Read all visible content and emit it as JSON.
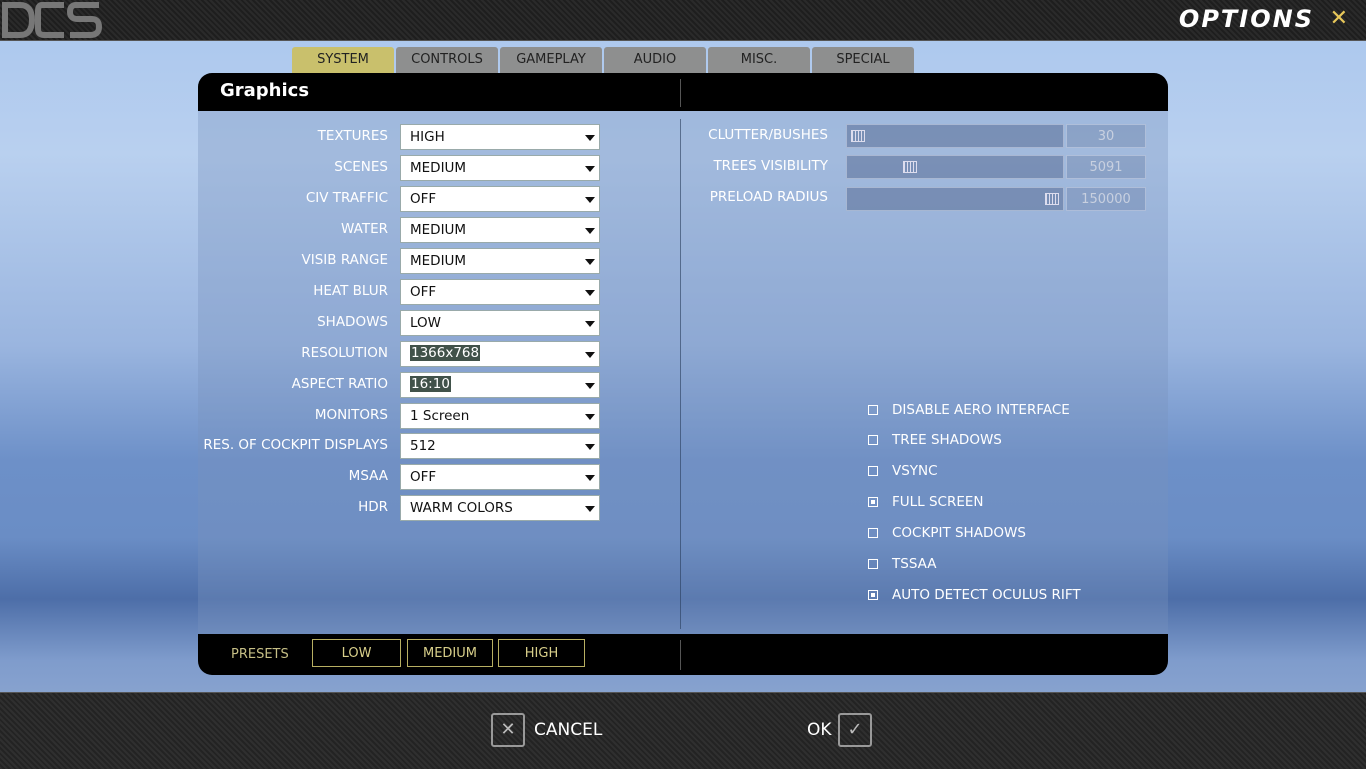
{
  "window": {
    "title": "OPTIONS",
    "close_icon": "close-icon"
  },
  "tabs": [
    {
      "label": "SYSTEM",
      "active": true
    },
    {
      "label": "CONTROLS",
      "active": false
    },
    {
      "label": "GAMEPLAY",
      "active": false
    },
    {
      "label": "AUDIO",
      "active": false
    },
    {
      "label": "MISC.",
      "active": false
    },
    {
      "label": "SPECIAL",
      "active": false
    }
  ],
  "panel": {
    "title": "Graphics"
  },
  "settings": [
    {
      "label": "TEXTURES",
      "value": "HIGH"
    },
    {
      "label": "SCENES",
      "value": "MEDIUM"
    },
    {
      "label": "CIV TRAFFIC",
      "value": "OFF"
    },
    {
      "label": "WATER",
      "value": "MEDIUM"
    },
    {
      "label": "VISIB RANGE",
      "value": "MEDIUM"
    },
    {
      "label": "HEAT BLUR",
      "value": "OFF"
    },
    {
      "label": "SHADOWS",
      "value": "LOW"
    },
    {
      "label": "RESOLUTION",
      "value": "1366x768"
    },
    {
      "label": "ASPECT RATIO",
      "value": "16:10"
    },
    {
      "label": "MONITORS",
      "value": "1 Screen"
    },
    {
      "label": "RES. OF COCKPIT DISPLAYS",
      "value": "512"
    },
    {
      "label": "MSAA",
      "value": "OFF"
    },
    {
      "label": "HDR",
      "value": "WARM COLORS"
    }
  ],
  "sliders": [
    {
      "label": "CLUTTER/BUSHES",
      "value": "30",
      "level": 0.0
    },
    {
      "label": "TREES VISIBILITY",
      "value": "5091",
      "level": 0.27
    },
    {
      "label": "PRELOAD RADIUS",
      "value": "150000",
      "level": 1.0
    }
  ],
  "checkboxes": [
    {
      "label": "DISABLE AERO INTERFACE",
      "checked": false
    },
    {
      "label": "TREE SHADOWS",
      "checked": false
    },
    {
      "label": "VSYNC",
      "checked": false
    },
    {
      "label": "FULL SCREEN",
      "checked": true
    },
    {
      "label": "COCKPIT SHADOWS",
      "checked": false
    },
    {
      "label": "TSSAA",
      "checked": false
    },
    {
      "label": "AUTO DETECT OCULUS RIFT",
      "checked": true
    }
  ],
  "presets": {
    "label": "PRESETS",
    "buttons": [
      "LOW",
      "MEDIUM",
      "HIGH"
    ]
  },
  "footer": {
    "cancel_label": "CANCEL",
    "ok_label": "OK"
  },
  "colors": {
    "accent": "#c9c06c",
    "tab": "#8e8f8f",
    "panel_bar": "#000000"
  }
}
